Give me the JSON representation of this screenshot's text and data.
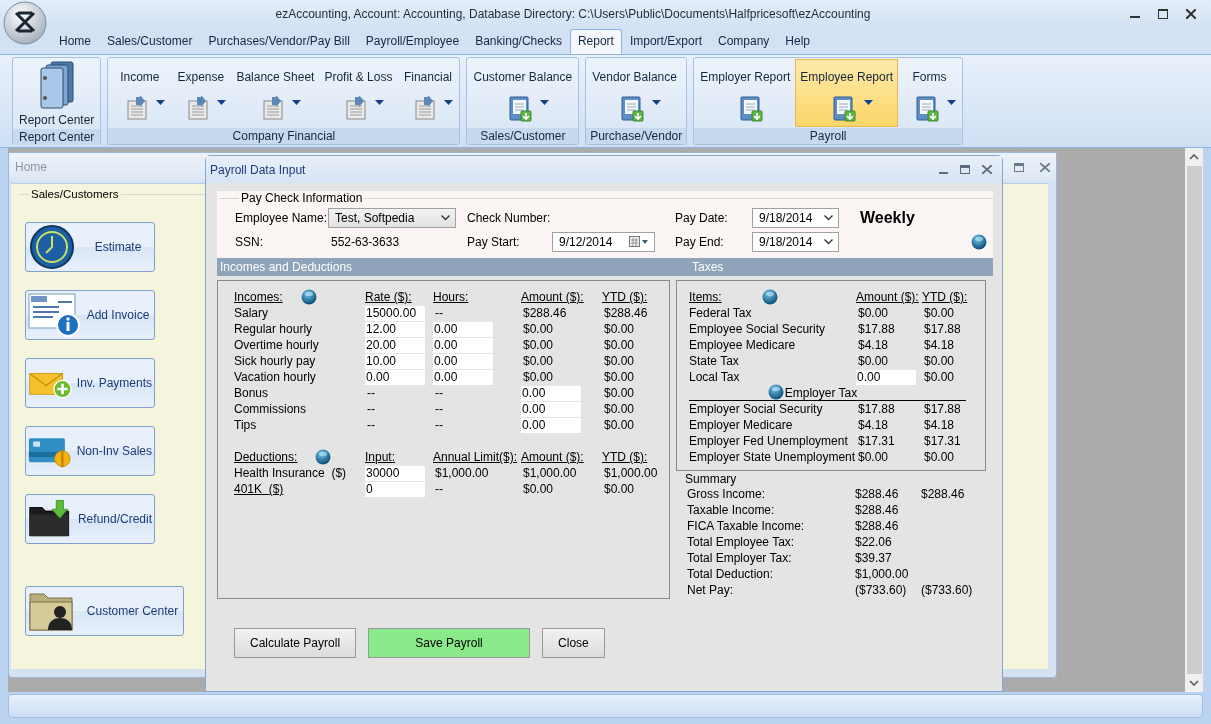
{
  "window": {
    "title": "ezAccounting, Account: Accounting, Database Directory: C:\\Users\\Public\\Documents\\Halfpricesoft\\ezAccounting"
  },
  "menu_tabs": [
    {
      "label": "Home",
      "selected": false
    },
    {
      "label": "Sales/Customer",
      "selected": false
    },
    {
      "label": "Purchases/Vendor/Pay Bill",
      "selected": false
    },
    {
      "label": "Payroll/Employee",
      "selected": false
    },
    {
      "label": "Banking/Checks",
      "selected": false
    },
    {
      "label": "Report",
      "selected": true
    },
    {
      "label": "Import/Export",
      "selected": false
    },
    {
      "label": "Company",
      "selected": false
    },
    {
      "label": "Help",
      "selected": false
    }
  ],
  "ribbon": {
    "groups": [
      {
        "label": "Report Center",
        "buttons": [
          {
            "label": "Report Center",
            "kind": "binder",
            "highlighted": false,
            "dropdown": false
          }
        ]
      },
      {
        "label": "Company Financial",
        "buttons": [
          {
            "label": "Income",
            "kind": "sheet",
            "highlighted": false,
            "dropdown": true
          },
          {
            "label": "Expense",
            "kind": "sheet",
            "highlighted": false,
            "dropdown": true
          },
          {
            "label": "Balance Sheet",
            "kind": "sheet",
            "highlighted": false,
            "dropdown": true
          },
          {
            "label": "Profit & Loss",
            "kind": "sheet",
            "highlighted": false,
            "dropdown": true
          },
          {
            "label": "Financial",
            "kind": "sheet",
            "highlighted": false,
            "dropdown": true
          }
        ]
      },
      {
        "label": "Sales/Customer",
        "buttons": [
          {
            "label": "Customer Balance",
            "kind": "book",
            "highlighted": false,
            "dropdown": true
          }
        ]
      },
      {
        "label": "Purchase/Vendor",
        "buttons": [
          {
            "label": "Vendor Balance",
            "kind": "book",
            "highlighted": false,
            "dropdown": true
          }
        ]
      },
      {
        "label": "Payroll",
        "buttons": [
          {
            "label": "Employer Report",
            "kind": "book",
            "highlighted": false,
            "dropdown": false
          },
          {
            "label": "Employee Report",
            "kind": "book",
            "highlighted": true,
            "dropdown": true
          },
          {
            "label": "Forms",
            "kind": "book",
            "highlighted": false,
            "dropdown": true
          }
        ]
      }
    ]
  },
  "home_window": {
    "title": "Home",
    "section": "Sales/Customers",
    "buttons": [
      "Estimate",
      "Add Invoice",
      "Inv. Payments",
      "Non-Inv Sales",
      "Refund/Credit",
      "Customer Center"
    ]
  },
  "dialog": {
    "title": "Payroll Data Input",
    "pay_check": {
      "legend": "Pay Check Information",
      "employee_name_label": "Employee Name:",
      "employee_name": "Test, Softpedia",
      "ssn_label": "SSN:",
      "ssn": "552-63-3633",
      "check_number_label": "Check Number:",
      "pay_start_label": "Pay Start:",
      "pay_start": "9/12/2014",
      "pay_date_label": "Pay Date:",
      "pay_date": "9/18/2014",
      "pay_end_label": "Pay End:",
      "pay_end": "9/18/2014",
      "frequency": "Weekly"
    },
    "incomes_heading": "Incomes and Deductions",
    "taxes_heading": "Taxes",
    "incomes": {
      "columns": [
        "Incomes:",
        "Rate ($):",
        "Hours:",
        "Amount ($):",
        "YTD ($):"
      ],
      "rows": [
        {
          "cells": [
            {
              "kind": "label",
              "value": "Salary"
            },
            {
              "kind": "input",
              "value": "15000.00"
            },
            {
              "kind": "text",
              "value": "--"
            },
            {
              "kind": "text",
              "value": "$288.46"
            },
            {
              "kind": "text",
              "value": "$288.46"
            }
          ]
        },
        {
          "cells": [
            {
              "kind": "label",
              "value": "Regular hourly"
            },
            {
              "kind": "input",
              "value": "12.00"
            },
            {
              "kind": "input",
              "value": "0.00"
            },
            {
              "kind": "text",
              "value": "$0.00"
            },
            {
              "kind": "text",
              "value": "$0.00"
            }
          ]
        },
        {
          "cells": [
            {
              "kind": "label",
              "value": "Overtime hourly"
            },
            {
              "kind": "input",
              "value": "20.00"
            },
            {
              "kind": "input",
              "value": "0.00"
            },
            {
              "kind": "text",
              "value": "$0.00"
            },
            {
              "kind": "text",
              "value": "$0.00"
            }
          ]
        },
        {
          "cells": [
            {
              "kind": "label",
              "value": "Sick hourly pay"
            },
            {
              "kind": "input",
              "value": "10.00"
            },
            {
              "kind": "input",
              "value": "0.00"
            },
            {
              "kind": "text",
              "value": "$0.00"
            },
            {
              "kind": "text",
              "value": "$0.00"
            }
          ]
        },
        {
          "cells": [
            {
              "kind": "label",
              "value": "Vacation hourly"
            },
            {
              "kind": "input",
              "value": "0.00"
            },
            {
              "kind": "input",
              "value": "0.00"
            },
            {
              "kind": "text",
              "value": "$0.00"
            },
            {
              "kind": "text",
              "value": "$0.00"
            }
          ]
        },
        {
          "cells": [
            {
              "kind": "label",
              "value": "Bonus"
            },
            {
              "kind": "text",
              "value": "--"
            },
            {
              "kind": "text",
              "value": "--"
            },
            {
              "kind": "input",
              "value": "0.00"
            },
            {
              "kind": "text",
              "value": "$0.00"
            }
          ]
        },
        {
          "cells": [
            {
              "kind": "label",
              "value": "Commissions"
            },
            {
              "kind": "text",
              "value": "--"
            },
            {
              "kind": "text",
              "value": "--"
            },
            {
              "kind": "input",
              "value": "0.00"
            },
            {
              "kind": "text",
              "value": "$0.00"
            }
          ]
        },
        {
          "cells": [
            {
              "kind": "label",
              "value": "Tips"
            },
            {
              "kind": "text",
              "value": "--"
            },
            {
              "kind": "text",
              "value": "--"
            },
            {
              "kind": "input",
              "value": "0.00"
            },
            {
              "kind": "text",
              "value": "$0.00"
            }
          ]
        }
      ]
    },
    "deductions": {
      "columns": [
        "Deductions:",
        "Input:",
        "Annual Limit($):",
        "Amount ($):",
        "YTD ($):"
      ],
      "rows": [
        {
          "cells": [
            {
              "kind": "label",
              "value": "Health Insurance  ($)"
            },
            {
              "kind": "input",
              "value": "30000"
            },
            {
              "kind": "text",
              "value": "$1,000.00"
            },
            {
              "kind": "text",
              "value": "$1,000.00"
            },
            {
              "kind": "text",
              "value": "$1,000.00"
            }
          ]
        },
        {
          "cells": [
            {
              "kind": "link",
              "value": "401K  ($)"
            },
            {
              "kind": "input",
              "value": "0"
            },
            {
              "kind": "text",
              "value": "--"
            },
            {
              "kind": "text",
              "value": "$0.00"
            },
            {
              "kind": "text",
              "value": "$0.00"
            }
          ]
        }
      ]
    },
    "taxes": {
      "columns": [
        "Items:",
        "Amount ($):",
        "YTD ($):"
      ],
      "employee_rows": [
        {
          "cells": [
            {
              "kind": "label",
              "value": "Federal Tax"
            },
            {
              "kind": "text",
              "value": "$0.00"
            },
            {
              "kind": "text",
              "value": "$0.00"
            }
          ]
        },
        {
          "cells": [
            {
              "kind": "label",
              "value": "Employee Social Security"
            },
            {
              "kind": "text",
              "value": "$17.88"
            },
            {
              "kind": "text",
              "value": "$17.88"
            }
          ]
        },
        {
          "cells": [
            {
              "kind": "label",
              "value": "Employee Medicare"
            },
            {
              "kind": "text",
              "value": "$4.18"
            },
            {
              "kind": "text",
              "value": "$4.18"
            }
          ]
        },
        {
          "cells": [
            {
              "kind": "label",
              "value": "State Tax"
            },
            {
              "kind": "text",
              "value": "$0.00"
            },
            {
              "kind": "text",
              "value": "$0.00"
            }
          ]
        },
        {
          "cells": [
            {
              "kind": "label",
              "value": "Local Tax"
            },
            {
              "kind": "input",
              "value": "0.00"
            },
            {
              "kind": "text",
              "value": "$0.00"
            }
          ]
        }
      ],
      "employer_heading": "Employer Tax",
      "employer_rows": [
        {
          "cells": [
            {
              "kind": "label",
              "value": "Employer Social Security"
            },
            {
              "kind": "text",
              "value": "$17.88"
            },
            {
              "kind": "text",
              "value": "$17.88"
            }
          ]
        },
        {
          "cells": [
            {
              "kind": "label",
              "value": "Employer Medicare"
            },
            {
              "kind": "text",
              "value": "$4.18"
            },
            {
              "kind": "text",
              "value": "$4.18"
            }
          ]
        },
        {
          "cells": [
            {
              "kind": "label",
              "value": "Employer Fed Unemployment"
            },
            {
              "kind": "text",
              "value": "$17.31"
            },
            {
              "kind": "text",
              "value": "$17.31"
            }
          ]
        },
        {
          "cells": [
            {
              "kind": "label",
              "value": "Employer State Unemployment"
            },
            {
              "kind": "text",
              "value": "$0.00"
            },
            {
              "kind": "text",
              "value": "$0.00"
            }
          ]
        }
      ]
    },
    "summary": {
      "title": "Summary",
      "rows": [
        {
          "label": "Gross Income:",
          "amount": "$288.46",
          "ytd": "$288.46"
        },
        {
          "label": "Taxable Income:",
          "amount": "$288.46"
        },
        {
          "label": "FICA Taxable Income:",
          "amount": "$288.46"
        },
        {
          "label": "Total Employee Tax:",
          "amount": "$22.06"
        },
        {
          "label": "Total Employer Tax:",
          "amount": "$39.37"
        },
        {
          "label": "Total Deduction:",
          "amount": "$1,000.00"
        },
        {
          "label": "Net Pay:",
          "amount": "($733.60)",
          "ytd": "($733.60)"
        }
      ]
    },
    "buttons": [
      {
        "label": "Calculate Payroll",
        "primary": false
      },
      {
        "label": "Save Payroll",
        "primary": true
      },
      {
        "label": "Close",
        "primary": false
      }
    ]
  }
}
